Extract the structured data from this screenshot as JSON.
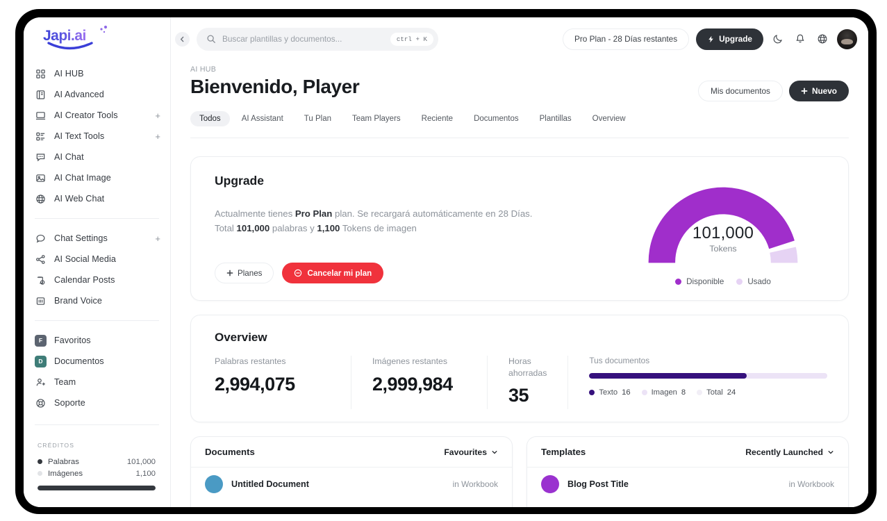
{
  "brand": {
    "logo_text": "Japi.ai"
  },
  "sidebar": {
    "groups": [
      {
        "items": [
          {
            "label": "AI HUB",
            "icon": "grid-icon",
            "expandable": false
          },
          {
            "label": "AI Advanced",
            "icon": "book-icon",
            "expandable": false
          },
          {
            "label": "AI Creator Tools",
            "icon": "monitor-icon",
            "expandable": true,
            "plus": "+"
          },
          {
            "label": "AI Text Tools",
            "icon": "list-icon",
            "expandable": true,
            "plus": "+"
          },
          {
            "label": "AI Chat",
            "icon": "chat-bubble-icon",
            "expandable": false
          },
          {
            "label": "AI Chat Image",
            "icon": "image-icon",
            "expandable": false
          },
          {
            "label": "AI Web Chat",
            "icon": "globe-icon",
            "expandable": false
          }
        ]
      },
      {
        "items": [
          {
            "label": "Chat Settings",
            "icon": "speech-icon",
            "expandable": true,
            "plus": "+"
          },
          {
            "label": "AI Social Media",
            "icon": "share-icon",
            "expandable": false
          },
          {
            "label": "Calendar Posts",
            "icon": "calendar-clock-icon",
            "expandable": false
          },
          {
            "label": "Brand Voice",
            "icon": "brand-icon",
            "expandable": false
          }
        ]
      },
      {
        "items": [
          {
            "label": "Favoritos",
            "icon": "letter-badge-f",
            "badge": "F",
            "badge_color": "#5c6470"
          },
          {
            "label": "Documentos",
            "icon": "letter-badge-d",
            "badge": "D",
            "badge_color": "#3f7d78"
          },
          {
            "label": "Team",
            "icon": "user-plus-icon",
            "expandable": false
          },
          {
            "label": "Soporte",
            "icon": "lifebuoy-icon",
            "expandable": false
          }
        ]
      }
    ],
    "credits": {
      "title": "CRÉDITOS",
      "rows": [
        {
          "label": "Palabras",
          "value": "101,000",
          "color": "#34383e"
        },
        {
          "label": "Imágenes",
          "value": "1,100",
          "color": "#e2e4e7"
        }
      ],
      "bar_percent": 100
    }
  },
  "topbar": {
    "collapse_icon": "chevron-left-icon",
    "search": {
      "placeholder": "Buscar plantillas y documentos...",
      "value": "",
      "shortcut": "ctrl + K"
    },
    "plan_pill": "Pro Plan - 28 Días restantes",
    "upgrade_label": "Upgrade",
    "icons": [
      "moon-icon",
      "bell-icon",
      "globe-icon"
    ]
  },
  "header": {
    "breadcrumb": "AI HUB",
    "title_prefix": "Bienvenido, ",
    "title_name": "Player",
    "my_documents_label": "Mis documentos",
    "new_label": "Nuevo",
    "tabs": [
      {
        "label": "Todos",
        "active": true
      },
      {
        "label": "AI Assistant",
        "active": false
      },
      {
        "label": "Tu Plan",
        "active": false
      },
      {
        "label": "Team Players",
        "active": false
      },
      {
        "label": "Reciente",
        "active": false
      },
      {
        "label": "Documentos",
        "active": false
      },
      {
        "label": "Plantillas",
        "active": false
      },
      {
        "label": "Overview",
        "active": false
      }
    ]
  },
  "upgrade_card": {
    "title": "Upgrade",
    "desc_1": "Actualmente tienes ",
    "desc_plan": "Pro Plan",
    "desc_2": " plan. Se recargará automáticamente en 28 Días. Total ",
    "desc_words": "101,000",
    "desc_3": " palabras y ",
    "desc_tokens": "1,100",
    "desc_4": " Tokens de imagen",
    "planes_label": "Planes",
    "cancel_label": "Cancelar mi plan",
    "cancel_color": "#f0323c"
  },
  "chart_data": [
    {
      "type": "pie",
      "title": "Tokens",
      "center_value": "101,000",
      "center_unit": "Tokens",
      "variant": "semicircle-gauge",
      "categories": [
        "Disponible",
        "Usado"
      ],
      "values": [
        95,
        5
      ],
      "colors": [
        "#a02ecb",
        "#e6d3f4"
      ],
      "legend": [
        "Disponible",
        "Usado"
      ],
      "legend_position": "bottom"
    },
    {
      "type": "bar",
      "variant": "stacked-progress",
      "title": "Tus documentos",
      "categories": [
        "Texto",
        "Imagen",
        "Total"
      ],
      "values": [
        16,
        8,
        24
      ],
      "colors": [
        "#36117d",
        "#ece3f6",
        "#f1eef6"
      ],
      "legend": [
        "Texto",
        "Imagen",
        "Total"
      ],
      "legend_position": "bottom"
    }
  ],
  "overview_card": {
    "title": "Overview",
    "stats": [
      {
        "label": "Palabras restantes",
        "value": "2,994,075"
      },
      {
        "label": "Imágenes restantes",
        "value": "2,999,984"
      },
      {
        "label": "Horas ahorradas",
        "value": "35"
      }
    ],
    "docs_meter": {
      "label": "Tus documentos",
      "legend": [
        {
          "label": "Texto",
          "value": "16",
          "color": "#36117d"
        },
        {
          "label": "Imagen",
          "value": "8",
          "color": "#ece3f6"
        },
        {
          "label": "Total",
          "value": "24",
          "color": "#f1eef6"
        }
      ],
      "filled_percent": 66
    }
  },
  "panels": [
    {
      "title": "Documents",
      "filter": "Favourites",
      "row": {
        "name": "Untitled Document",
        "meta": "in Workbook",
        "thumb_color": "#4a9ac4"
      }
    },
    {
      "title": "Templates",
      "filter": "Recently Launched",
      "row": {
        "name": "Blog Post Title",
        "meta": "in Workbook",
        "thumb_color": "#9a32cf"
      }
    }
  ]
}
